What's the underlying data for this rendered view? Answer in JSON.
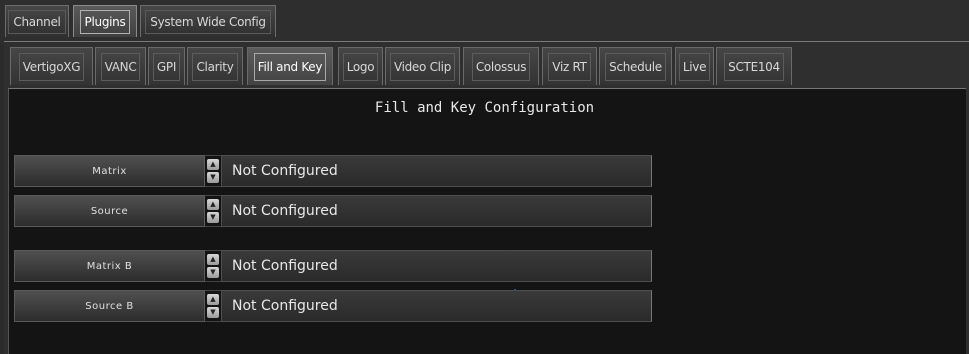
{
  "top_tabs": [
    {
      "label": "Channel",
      "active": false
    },
    {
      "label": "Plugins",
      "active": true
    },
    {
      "label": "System Wide Config",
      "active": false
    }
  ],
  "plugin_tabs": [
    {
      "label": "VertigoXG",
      "active": false
    },
    {
      "label": "VANC",
      "active": false
    },
    {
      "label": "GPI",
      "active": false
    },
    {
      "label": "Clarity",
      "active": false
    },
    {
      "label": "Fill and Key",
      "active": true
    },
    {
      "label": "Logo",
      "active": false
    },
    {
      "label": "Video Clip",
      "active": false
    },
    {
      "label": "Colossus",
      "active": false
    },
    {
      "label": "Viz RT",
      "active": false
    },
    {
      "label": "Schedule",
      "active": false
    },
    {
      "label": "Live",
      "active": false
    },
    {
      "label": "SCTE104",
      "active": false
    }
  ],
  "panel": {
    "title": "Fill and Key Configuration",
    "rows": [
      {
        "label": "Matrix",
        "value": "Not Configured"
      },
      {
        "label": "Source",
        "value": "Not Configured"
      },
      {
        "label": "Matrix B",
        "value": "Not Configured"
      },
      {
        "label": "Source B",
        "value": "Not Configured"
      }
    ]
  }
}
